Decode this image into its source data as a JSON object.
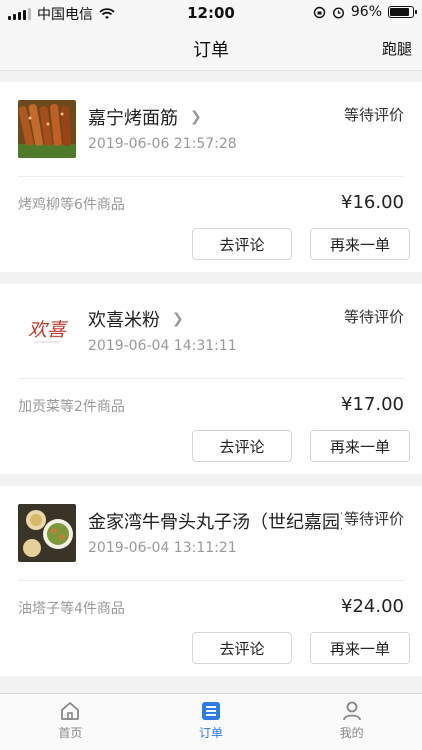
{
  "status_bar": {
    "carrier": "中国电信",
    "time": "12:00",
    "battery": "96%",
    "battery_level": 0.96
  },
  "nav": {
    "title": "订单",
    "right_label": "跑腿"
  },
  "orders": [
    {
      "shop": "嘉宁烤面筋",
      "time": "2019-06-06 21:57:28",
      "status": "等待评价",
      "summary": "烤鸡柳等6件商品",
      "price": "¥16.00",
      "review_label": "去评论",
      "reorder_label": "再来一单"
    },
    {
      "shop": "欢喜米粉",
      "time": "2019-06-04 14:31:11",
      "status": "等待评价",
      "summary": "加贡菜等2件商品",
      "price": "¥17.00",
      "review_label": "去评论",
      "reorder_label": "再来一单",
      "logo_text": "欢喜"
    },
    {
      "shop": "金家湾牛骨头丸子汤（世纪嘉园）",
      "time": "2019-06-04 13:11:21",
      "status": "等待评价",
      "summary": "油塔子等4件商品",
      "price": "¥24.00",
      "review_label": "去评论",
      "reorder_label": "再来一单"
    }
  ],
  "tabs": [
    {
      "label": "首页",
      "icon": "home-icon"
    },
    {
      "label": "订单",
      "icon": "order-list-icon",
      "active": true
    },
    {
      "label": "我的",
      "icon": "profile-icon"
    }
  ],
  "colors": {
    "accent": "#2d7ce8",
    "background": "#f2f2f2"
  }
}
